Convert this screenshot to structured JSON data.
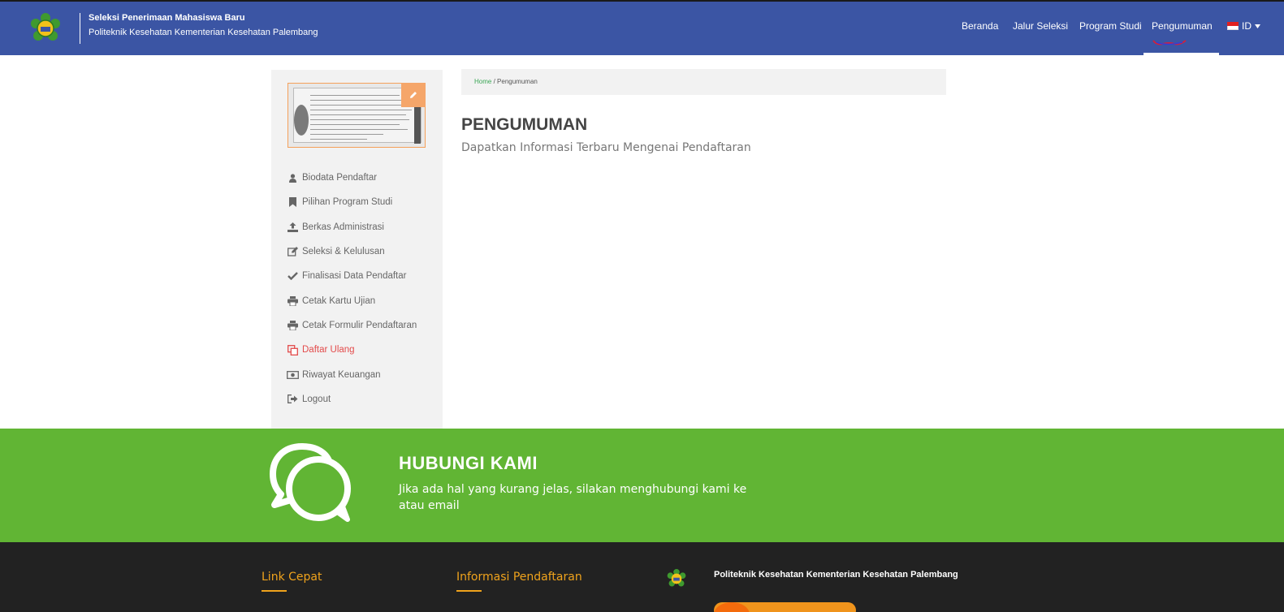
{
  "header": {
    "brand_title": "Seleksi Penerimaan Mahasiswa Baru",
    "brand_subtitle": "Politeknik Kesehatan Kementerian Kesehatan Palembang",
    "nav": [
      {
        "label": "Beranda"
      },
      {
        "label": "Jalur Seleksi"
      },
      {
        "label": "Program Studi"
      },
      {
        "label": "Pengumuman",
        "active": true
      }
    ],
    "language": "ID"
  },
  "sidebar": {
    "items": [
      {
        "label": "Biodata Pendaftar",
        "icon": "user-icon"
      },
      {
        "label": "Pilihan Program Studi",
        "icon": "bookmark-icon"
      },
      {
        "label": "Berkas Administrasi",
        "icon": "upload-icon"
      },
      {
        "label": "Seleksi & Kelulusan",
        "icon": "edit-icon"
      },
      {
        "label": "Finalisasi Data Pendaftar",
        "icon": "check-icon"
      },
      {
        "label": "Cetak Kartu Ujian",
        "icon": "print-icon"
      },
      {
        "label": "Cetak Formulir Pendaftaran",
        "icon": "print-icon"
      },
      {
        "label": "Daftar Ulang",
        "icon": "copy-icon",
        "active": true
      },
      {
        "label": "Riwayat Keuangan",
        "icon": "money-icon"
      },
      {
        "label": "Logout",
        "icon": "sign-out-icon"
      }
    ]
  },
  "breadcrumb": {
    "home": "Home",
    "separator": "/",
    "current": "Pengumuman"
  },
  "main": {
    "title": "PENGUMUMAN",
    "subtitle": "Dapatkan Informasi Terbaru Mengenai Pendaftaran"
  },
  "contact": {
    "title": "HUBUNGI KAMI",
    "text": "Jika ada hal yang kurang jelas, silakan menghubungi kami ke atau email"
  },
  "footer": {
    "col1_title": "Link Cepat",
    "col2_title": "Informasi Pendaftaran",
    "institution": "Politeknik Kesehatan Kementerian Kesehatan Palembang"
  },
  "colors": {
    "header": "#3b55a4",
    "accent_green": "#61b534",
    "footer": "#222222",
    "footer_heading": "#f0a31c",
    "active_menu": "#e34b4b"
  }
}
